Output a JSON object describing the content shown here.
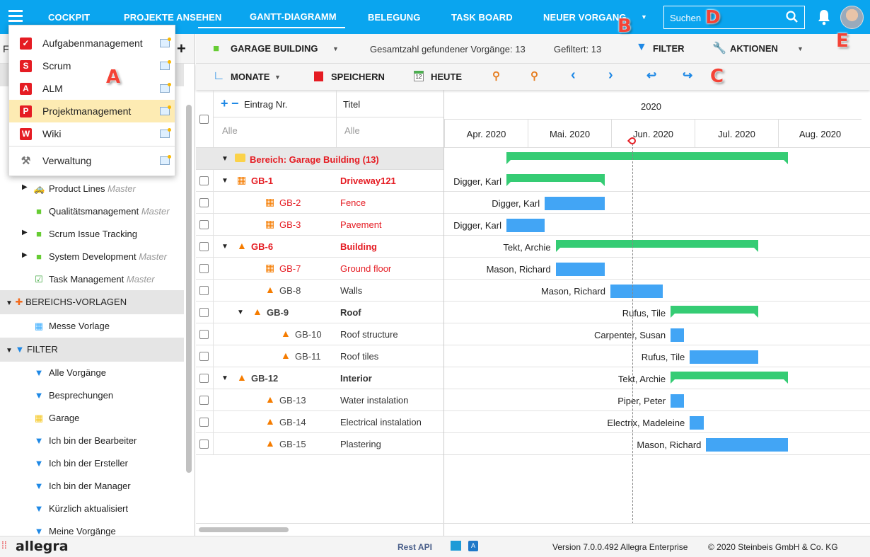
{
  "topbar": {
    "nav": [
      "COCKPIT",
      "PROJEKTE ANSEHEN",
      "GANTT-DIAGRAMM",
      "BELEGUNG",
      "TASK BOARD",
      "NEUER VORGANG"
    ],
    "active": "GANTT-DIAGRAMM",
    "search_placeholder": "Suchen"
  },
  "colors": {
    "brand": "#0aa5ef",
    "summary_bar": "#35cc74",
    "task_bar": "#42a5f5",
    "red_text": "#e51c23",
    "highlight": "#fdebb3"
  },
  "menu": {
    "items": [
      "Aufgabenmanagement",
      "Scrum",
      "ALM",
      "Projektmanagement",
      "Wiki",
      "Verwaltung"
    ],
    "icons": [
      "✓",
      "S",
      "A",
      "P",
      "W",
      "⚒"
    ],
    "highlighted": "Projektmanagement"
  },
  "sidebar": {
    "header_letter": "F",
    "add": "+",
    "projects": [
      {
        "label": "Product Lines",
        "tag": "Master"
      },
      {
        "label": "Qualitätsmanagement",
        "tag": "Master"
      },
      {
        "label": "Scrum Issue Tracking",
        "tag": ""
      },
      {
        "label": "System Development",
        "tag": "Master"
      },
      {
        "label": "Task Management",
        "tag": "Master"
      }
    ],
    "section_templates": "BEREICHS-VORLAGEN",
    "templates": [
      "Messe Vorlage"
    ],
    "section_filter": "FILTER",
    "filters": [
      "Alle Vorgänge",
      "Besprechungen",
      "Garage",
      "Ich bin der Bearbeiter",
      "Ich bin der Ersteller",
      "Ich bin der Manager",
      "Kürzlich aktualisiert",
      "Meine Vorgänge"
    ]
  },
  "toolbar": {
    "project": "GARAGE BUILDING",
    "total": "Gesamtzahl gefundener Vorgänge: 13",
    "filtered": "Gefiltert: 13",
    "filter": "FILTER",
    "actions": "AKTIONEN"
  },
  "toolbar2": {
    "scale": "MONATE",
    "save": "SPEICHERN",
    "today": "HEUTE"
  },
  "table": {
    "col_id": "Eintrag Nr.",
    "col_title": "Titel",
    "filter_id": "Alle",
    "filter_title": "Alle",
    "expand": "+",
    "collapse": "−",
    "group": "Bereich: Garage Building (13)",
    "rows": [
      {
        "id": "GB-1",
        "title": "Driveway121",
        "level": 1,
        "icon": "milestone-warning",
        "red": true,
        "bold": true,
        "expander": true,
        "resource": "Digger, Karl",
        "start": "2020-04-24",
        "end": "2020-05-30",
        "type": "summary"
      },
      {
        "id": "GB-2",
        "title": "Fence",
        "level": 2,
        "icon": "milestone-warning",
        "red": true,
        "bold": false,
        "expander": false,
        "resource": "Digger, Karl",
        "start": "2020-05-08",
        "end": "2020-05-30",
        "type": "task"
      },
      {
        "id": "GB-3",
        "title": "Pavement",
        "level": 2,
        "icon": "milestone-warning",
        "red": true,
        "bold": false,
        "expander": false,
        "resource": "Digger, Karl",
        "start": "2020-04-24",
        "end": "2020-05-08",
        "type": "task"
      },
      {
        "id": "GB-6",
        "title": "Building",
        "level": 1,
        "icon": "cone",
        "red": true,
        "bold": true,
        "expander": true,
        "resource": "Tekt, Archie",
        "start": "2020-05-12",
        "end": "2020-07-25",
        "type": "summary"
      },
      {
        "id": "GB-7",
        "title": "Ground floor",
        "level": 2,
        "icon": "milestone-warning",
        "red": true,
        "bold": false,
        "expander": false,
        "resource": "Mason, Richard",
        "start": "2020-05-12",
        "end": "2020-05-30",
        "type": "task"
      },
      {
        "id": "GB-8",
        "title": "Walls",
        "level": 2,
        "icon": "cone",
        "red": false,
        "bold": false,
        "expander": false,
        "resource": "Mason, Richard",
        "start": "2020-06-01",
        "end": "2020-06-20",
        "type": "task"
      },
      {
        "id": "GB-9",
        "title": "Roof",
        "level": 2,
        "icon": "cone",
        "red": false,
        "bold": true,
        "expander": true,
        "resource": "Rufus, Tile",
        "start": "2020-06-23",
        "end": "2020-07-25",
        "type": "summary"
      },
      {
        "id": "GB-10",
        "title": "Roof structure",
        "level": 3,
        "icon": "cone",
        "red": false,
        "bold": false,
        "expander": false,
        "resource": "Carpenter, Susan",
        "start": "2020-06-23",
        "end": "2020-06-28",
        "type": "task"
      },
      {
        "id": "GB-11",
        "title": "Roof tiles",
        "level": 3,
        "icon": "cone",
        "red": false,
        "bold": false,
        "expander": false,
        "resource": "Rufus, Tile",
        "start": "2020-06-30",
        "end": "2020-07-25",
        "type": "task"
      },
      {
        "id": "GB-12",
        "title": "Interior",
        "level": 1,
        "icon": "cone",
        "red": false,
        "bold": true,
        "expander": true,
        "resource": "Tekt, Archie",
        "start": "2020-06-23",
        "end": "2020-08-05",
        "type": "summary"
      },
      {
        "id": "GB-13",
        "title": "Water instalation",
        "level": 2,
        "icon": "cone",
        "red": false,
        "bold": false,
        "expander": false,
        "resource": "Piper, Peter",
        "start": "2020-06-23",
        "end": "2020-06-28",
        "type": "task"
      },
      {
        "id": "GB-14",
        "title": "Electrical instalation",
        "level": 2,
        "icon": "cone",
        "red": false,
        "bold": false,
        "expander": false,
        "resource": "Electrix, Madeleine",
        "start": "2020-06-30",
        "end": "2020-07-05",
        "type": "task"
      },
      {
        "id": "GB-15",
        "title": "Plastering",
        "level": 2,
        "icon": "cone",
        "red": false,
        "bold": false,
        "expander": false,
        "resource": "Mason, Richard",
        "start": "2020-07-06",
        "end": "2020-08-05",
        "type": "task"
      }
    ]
  },
  "gantt": {
    "year": "2020",
    "months": [
      "Apr. 2020",
      "Mai. 2020",
      "Jun. 2020",
      "Jul. 2020",
      "Aug. 2020"
    ],
    "today": "2020-06-09",
    "group_bar": {
      "start": "2020-04-24",
      "end": "2020-08-05"
    }
  },
  "footer": {
    "logo": "allegra",
    "rest_api": "Rest API",
    "version": "Version 7.0.0.492 Allegra Enterprise",
    "copyright": "© 2020 Steinbeis GmbH & Co. KG"
  },
  "annotations": [
    "A",
    "B",
    "C",
    "D",
    "E"
  ]
}
